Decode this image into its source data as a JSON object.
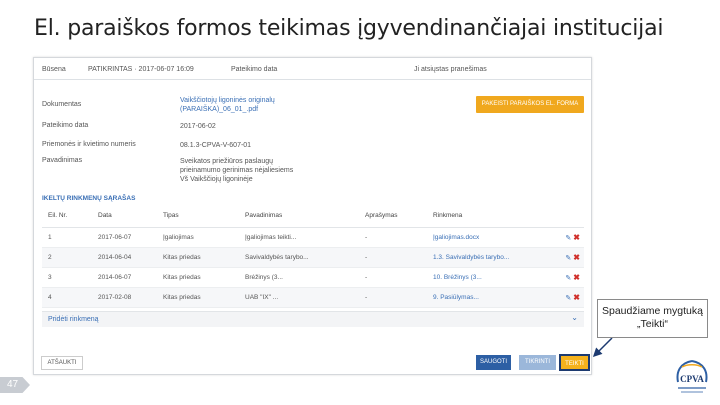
{
  "slide": {
    "title": "El. paraiškos formos teikimas įgyvendinančiajai institucijai",
    "page_number": "47",
    "callout": "Spaudžiame mygtuką „Teikti“"
  },
  "status_bar": {
    "status_label": "Būsena",
    "status_value": "PATIKRINTAS · 2017-06-07 16:09",
    "date_label": "Pateikimo data",
    "notification": "Ji atsiųstas pranešimas"
  },
  "fields": [
    {
      "label": "Dokumentas",
      "value_lines": [
        "Vaikščiotojų ligoninės originalų",
        "(PARAIŠKA)_06_01_.pdf"
      ],
      "is_link": true
    },
    {
      "label": "Pateikimo data",
      "value_lines": [
        "2017-06-02"
      ],
      "is_link": false
    },
    {
      "label": "Priemonės ir kvietimo numeris",
      "value_lines": [
        "08.1.3-CPVA-V-607-01"
      ],
      "is_link": false
    },
    {
      "label": "Pavadinimas",
      "value_lines": [
        "Sveikatos priežiūros paslaugų",
        "prieinamumo gerinimas nėjaliesiems",
        "Vš Vaikščiojų ligoninėje"
      ],
      "is_link": false
    }
  ],
  "buttons": {
    "attach_form": "PAKEISTI PARAIŠKOS EL. FORMA",
    "cancel": "ATŠAUKTI",
    "save": "SAUGOTI",
    "edit": "TIKRINTI",
    "submit": "TEIKTI"
  },
  "attachments": {
    "section_title": "IKELTŲ RINKMENŲ SĄRAŠAS",
    "columns": [
      "Eil. Nr.",
      "Data",
      "Tipas",
      "Pavadinimas",
      "Aprašymas",
      "Rinkmena"
    ],
    "rows": [
      {
        "nr": "1",
        "date": "2017-06-07",
        "type": "Įgaliojimas",
        "name": "Įgaliojimas teikti...",
        "description": "-",
        "file": "Įgaliojimas.docx"
      },
      {
        "nr": "2",
        "date": "2014-06-04",
        "type": "Kitas priedas",
        "name": "Savivaldybės tarybo...",
        "description": "-",
        "file": "1.3. Savivaldybės tarybo..."
      },
      {
        "nr": "3",
        "date": "2014-06-07",
        "type": "Kitas priedas",
        "name": "Brėžinys (3...",
        "description": "-",
        "file": "10. Brėžinys (3..."
      },
      {
        "nr": "4",
        "date": "2017-02-08",
        "type": "Kitas priedas",
        "name": "UAB \"IX\" ...",
        "description": "-",
        "file": "9. Pasiūlymas..."
      }
    ],
    "add_label": "Pridėti rinkmeną"
  },
  "colors": {
    "accent_blue": "#2d5fa4",
    "link_blue": "#3a6fb5",
    "orange": "#f0a81e",
    "submit_yellow": "#f5b21c",
    "highlight_box": "#1c3a70",
    "delete_red": "#d0302b"
  },
  "logo": {
    "text": "CPVA"
  }
}
